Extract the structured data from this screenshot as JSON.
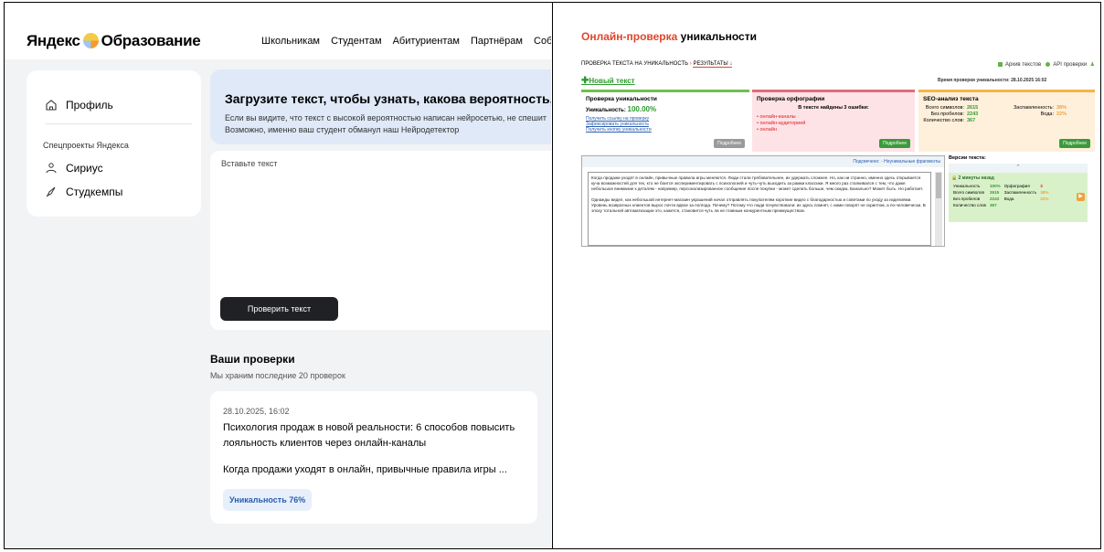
{
  "left": {
    "logo": {
      "brand": "Яндекс",
      "product": "Образование"
    },
    "nav": [
      "Школьникам",
      "Студентам",
      "Абитуриентам",
      "Партнёрам",
      "События"
    ],
    "sidebar": {
      "profile": "Профиль",
      "caption": "Спецпроекты Яндекса",
      "items": [
        "Сириус",
        "Студкемпы"
      ]
    },
    "banner": {
      "title": "Загрузите текст, чтобы узнать, какова вероятность, что ег",
      "line1": "Если вы видите, что текст с высокой вероятностью написан нейросетью, не спешит",
      "line2": "Возможно, именно ваш студент обманул наш Нейродетектор"
    },
    "editor": {
      "placeholder": "Вставьте текст",
      "button": "Проверить текст"
    },
    "checks": {
      "title": "Ваши проверки",
      "subtitle": "Мы храним последние 20 проверок",
      "card": {
        "date": "28.10.2025, 16:02",
        "title": "Психология продаж в новой реальности: 6 способов повысить лояльность клиентов через онлайн-каналы",
        "excerpt": "Когда продажи уходят в онлайн, привычные правила игры ...",
        "badge": "Уникальность 76%"
      }
    }
  },
  "right": {
    "title_red": "Онлайн-проверка",
    "title_rest": " уникальности",
    "breadcrumb": {
      "item1": "ПРОВЕРКА ТЕКСТА НА УНИКАЛЬНОСТЬ",
      "sep": " › ",
      "item2": "РЕЗУЛЬТАТЫ ↓"
    },
    "links": {
      "archive": "Архив текстов",
      "api": "API проверки"
    },
    "new_text": "Новый текст",
    "check_time": "Время проверки уникальности: 28.10.2025 16:02",
    "uniqueness": {
      "title": "Проверка уникальности",
      "label": "Уникальность:",
      "value": "100.00%",
      "links": [
        "Получить ссылку на проверку",
        "Зафиксировать уникальность",
        "Получить кнопку уникальности"
      ],
      "more": "Подробнее"
    },
    "spelling": {
      "title": "Проверка орфографии",
      "subtitle": "В тексте найдены 3 ошибки:",
      "errors": [
        "• онлайн-каналы",
        "• онлайн-аудиторией",
        "• онлайн"
      ],
      "more": "Подробнее"
    },
    "seo": {
      "title": "SEO-анализ текста",
      "rows": [
        {
          "k": "Всего символов:",
          "v": "2615",
          "k2": "Заспамленность:",
          "v2": "38%"
        },
        {
          "k": "Без пробелов:",
          "v": "2243",
          "k2": "Вода:",
          "v2": "22%"
        },
        {
          "k": "Количество слов:",
          "v": "367",
          "k2": "",
          "v2": ""
        }
      ],
      "more": "Подробнее"
    },
    "text_area": {
      "top": "Подсвечено: ◦ Неуникальные фрагменты",
      "p1": "Когда продажи уходят в онлайн, привычные правила игры меняются. Люди стали требовательнее, их удержать сложнее. Но, как ни странно, именно здесь открывается куча возможностей для тех, кто не боится экспериментировать с психологией и чуть-чуть выходить за рамки классики. Я много раз сталкивался с тем, что даже небольшое внимание к деталям - например, персонализированное сообщение после покупки - может сделать больше, чем скидка. Банально? Может быть. Но работает.",
      "p2": "Однажды видел, как небольшой интернет-магазин украшений начал отправлять покупателям короткие видео с благодарностью и советами по уходу за изделиями. Уровень возвратных клиентов вырос почти вдвое за полгода. Почему? Потому что люди почувствовали: их здесь помнят, с ними говорят не скриптом, а по-человечески. В эпоху тотальной автоматизации это, кажется, становится чуть ли не главным конкурентным преимуществом."
    },
    "versions": {
      "title": "Версии текста:",
      "when": "🔒 2 минуты назад",
      "rows": [
        [
          "Уникальность",
          "100%",
          "Орфография",
          "3"
        ],
        [
          "Всего символов",
          "2615",
          "Заспамленность",
          "38%"
        ],
        [
          "Без пробелов",
          "2243",
          "Вода",
          "22%"
        ],
        [
          "Количество слов",
          "367",
          "",
          ""
        ]
      ]
    }
  }
}
